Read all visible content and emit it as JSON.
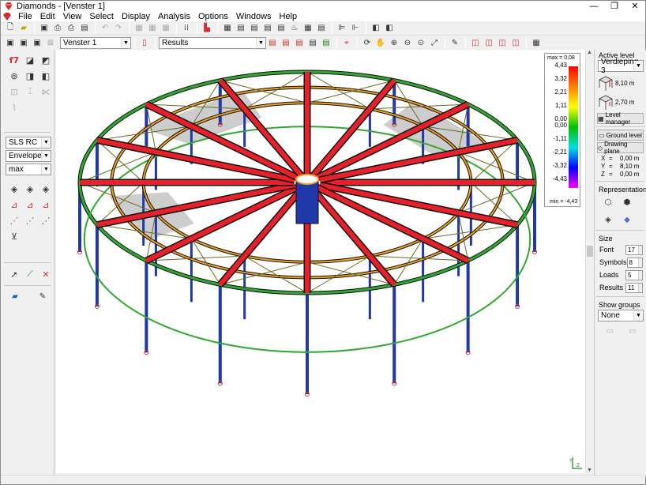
{
  "window": {
    "title": "Diamonds - [Venster 1]",
    "minimize": "—",
    "restore": "❐",
    "close": "✕"
  },
  "menu": [
    "File",
    "Edit",
    "View",
    "Select",
    "Display",
    "Analysis",
    "Options",
    "Windows",
    "Help"
  ],
  "toolbar2": {
    "view_combo": "Venster 1",
    "results_combo": "Results"
  },
  "left_panel": {
    "load_combo": "SLS RC",
    "envelope_combo": "Envelope",
    "max_combo": "max"
  },
  "legend": {
    "max_label": "max = 0,08",
    "min_label": "min = -4,43",
    "ticks": [
      "4,43",
      "3,32",
      "2,21",
      "1,11",
      "0,00",
      "0,00",
      "-1,11",
      "-2,21",
      "-3,32",
      "-4,43"
    ]
  },
  "right_panel": {
    "active_level_title": "Active level",
    "level_combo": "Verdieping 3",
    "level_height": "8,10 m",
    "level_thickness": "2,70 m",
    "level_manager": "Level manager",
    "ground_level": "Ground level",
    "drawing_plane": "Drawing plane",
    "coords": [
      {
        "axis": "X",
        "value": "0,00 m"
      },
      {
        "axis": "Y",
        "value": "8,10 m"
      },
      {
        "axis": "Z",
        "value": "0,00 m"
      }
    ],
    "representation_title": "Representation",
    "size_title": "Size",
    "sizes": [
      {
        "label": "Font",
        "value": "17"
      },
      {
        "label": "Symbols",
        "value": "8"
      },
      {
        "label": "Loads",
        "value": "5"
      },
      {
        "label": "Results",
        "value": "11"
      }
    ],
    "show_groups_title": "Show groups",
    "groups_combo": "None"
  },
  "colors": {
    "beam": "#e8202a",
    "column": "#1f3aa8",
    "ring_outer": "#2fa82f",
    "ring_inner": "#f0a020",
    "slab": "#c8c8c8",
    "edge": "#101010"
  }
}
